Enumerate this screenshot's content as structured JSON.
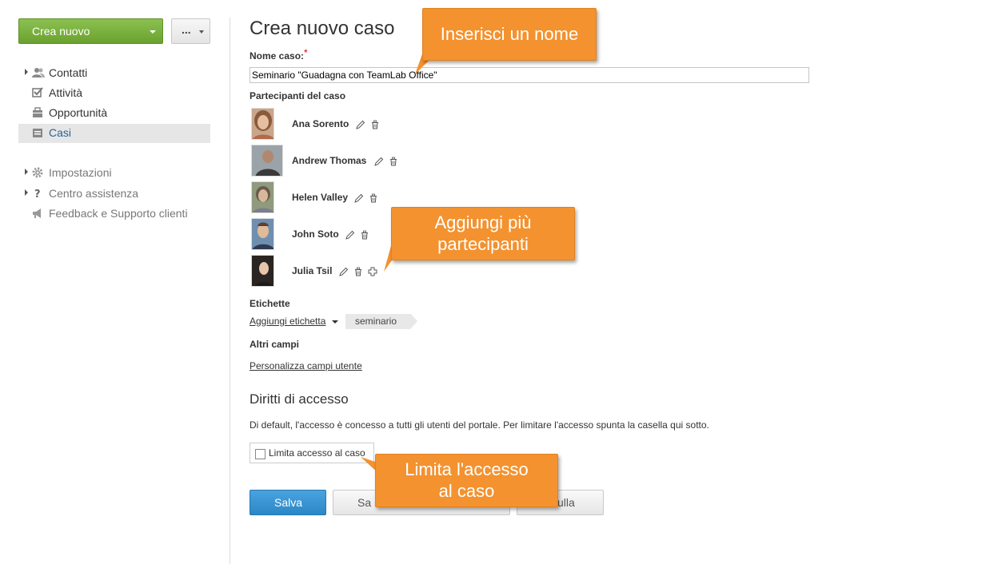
{
  "sidebar": {
    "create_button": "Crea nuovo",
    "more_button": "...",
    "items": [
      {
        "label": "Contatti",
        "icon": "contacts-icon"
      },
      {
        "label": "Attività",
        "icon": "tasks-icon"
      },
      {
        "label": "Opportunità",
        "icon": "opportunities-icon"
      },
      {
        "label": "Casi",
        "icon": "cases-icon",
        "active": true
      }
    ],
    "secondary_items": [
      {
        "label": "Impostazioni",
        "icon": "gear-icon"
      },
      {
        "label": "Centro assistenza",
        "icon": "question-icon"
      },
      {
        "label": "Feedback e Supporto clienti",
        "icon": "megaphone-icon"
      }
    ]
  },
  "main": {
    "title": "Crea nuovo caso",
    "case_name_label": "Nome caso:",
    "required_mark": "*",
    "case_name_value": "Seminario \"Guadagna con TeamLab Office\"",
    "participants_label": "Partecipanti del caso",
    "participants": [
      {
        "name": "Ana Sorento"
      },
      {
        "name": "Andrew Thomas"
      },
      {
        "name": "Helen Valley"
      },
      {
        "name": "John Soto"
      },
      {
        "name": "Julia Tsil"
      }
    ],
    "tags_label": "Etichette",
    "add_tag_link": "Aggiungi etichetta",
    "tags": [
      "seminario"
    ],
    "other_fields_label": "Altri campi",
    "customize_link": "Personalizza campi utente",
    "access_title": "Diritti di accesso",
    "access_desc": "Di default, l'accesso è concesso a tutti gli utenti del portale. Per limitare l'accesso spunta la casella qui sotto.",
    "restrict_checkbox": "Limita accesso al caso",
    "restrict_checked": false,
    "buttons": {
      "save": "Salva",
      "save_and_create_partial": "Sa",
      "cancel_partial": "ulla"
    }
  },
  "callouts": {
    "name": "Inserisci un nome",
    "participants_line1": "Aggiungi più",
    "participants_line2": "partecipanti",
    "access_line1": "Limita l'accesso",
    "access_line2": "al caso"
  },
  "colors": {
    "create_button": "#7ab23e",
    "save_button": "#3596d6",
    "callout": "#f3922f",
    "active_nav": "#2a6496"
  }
}
